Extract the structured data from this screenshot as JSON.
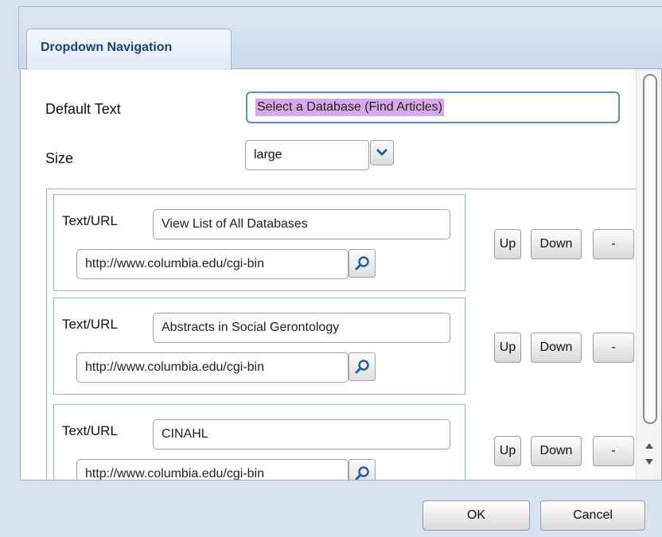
{
  "dialog": {
    "tab_label": "Dropdown Navigation"
  },
  "form": {
    "default_text_label": "Default Text",
    "default_text_value": "Select a Database (Find Articles)",
    "size_label": "Size",
    "size_value": "large"
  },
  "rows": [
    {
      "label": "Text/URL",
      "text": "View List of All Databases",
      "url": "http://www.columbia.edu/cgi-bin",
      "up": "Up",
      "down": "Down",
      "remove": "-"
    },
    {
      "label": "Text/URL",
      "text": "Abstracts in Social Gerontology",
      "url": "http://www.columbia.edu/cgi-bin",
      "up": "Up",
      "down": "Down",
      "remove": "-"
    },
    {
      "label": "Text/URL",
      "text": "CINAHL",
      "url": "http://www.columbia.edu/cgi-bin",
      "up": "Up",
      "down": "Down",
      "remove": "-"
    }
  ],
  "footer": {
    "ok_label": "OK",
    "cancel_label": "Cancel"
  },
  "icons": {
    "search": "search-icon",
    "dropdown": "chevron-down-icon"
  },
  "colors": {
    "tab_text": "#15428b",
    "selection_highlight": "#d9a8e8",
    "focus_border": "#5b8fd0"
  }
}
